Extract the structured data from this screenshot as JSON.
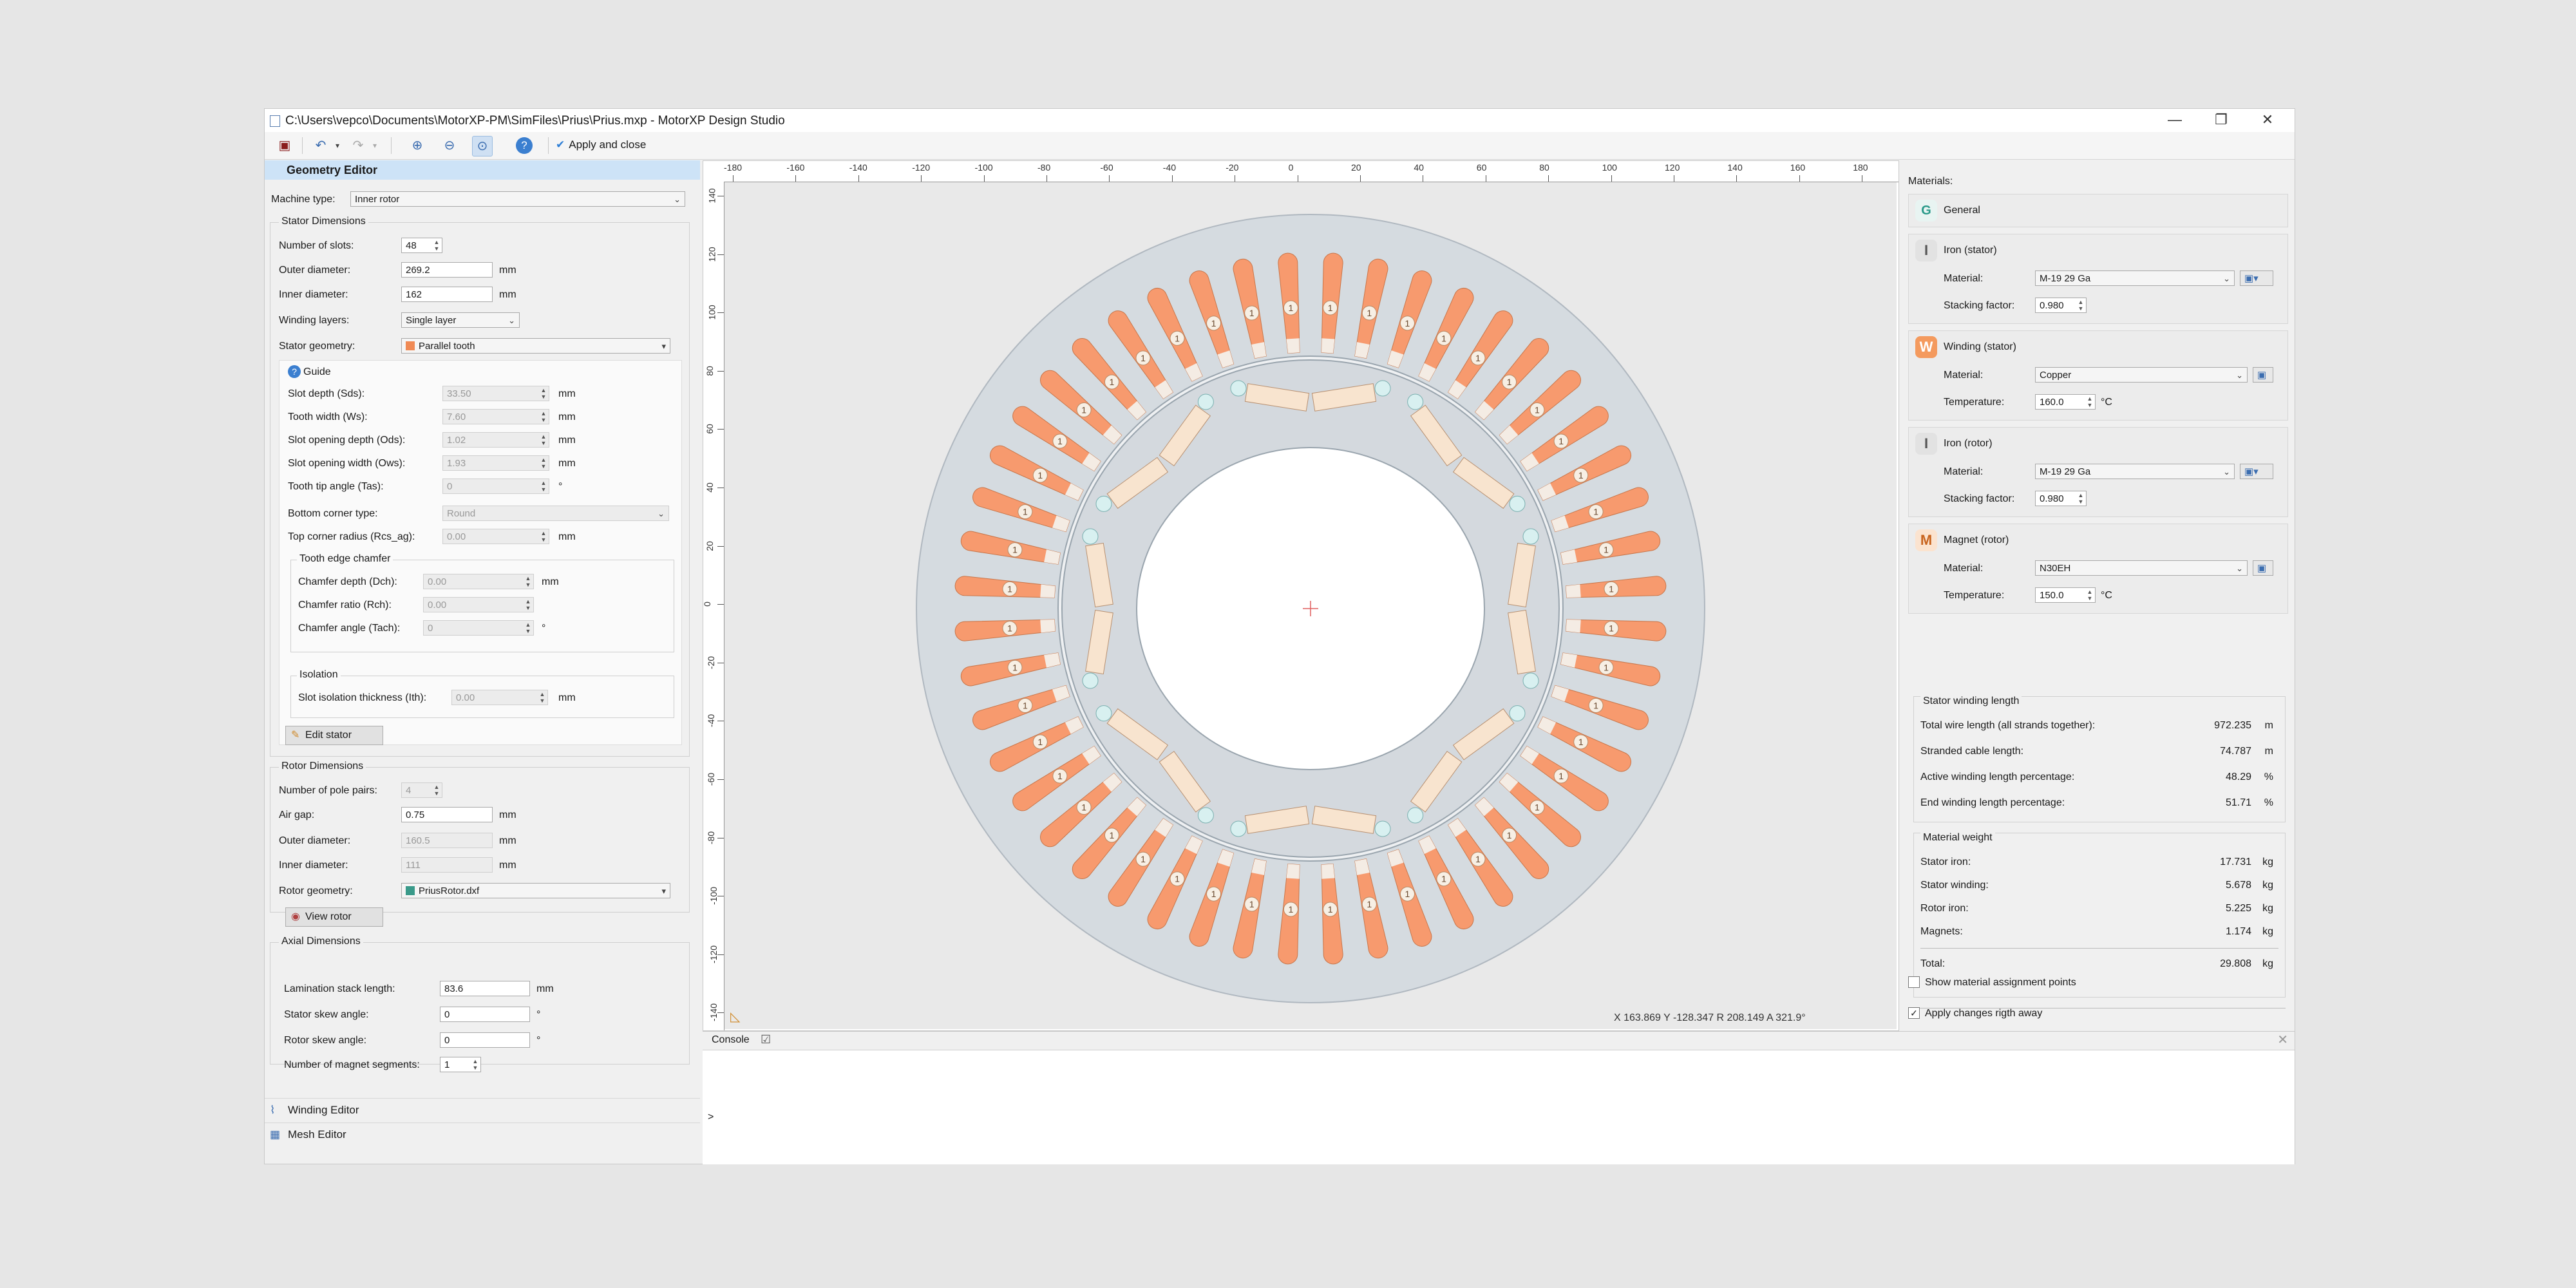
{
  "window": {
    "title": "C:\\Users\\vepco\\Documents\\MotorXP-PM\\SimFiles\\Prius\\Prius.mxp - MotorXP Design Studio",
    "minimize": "—",
    "maximize": "❐",
    "close": "✕"
  },
  "toolbar": {
    "apply_label": "Apply and close"
  },
  "left": {
    "header": "Geometry Editor",
    "machine_type_label": "Machine type:",
    "machine_type": "Inner rotor",
    "stator_group": "Stator Dimensions",
    "slots_label": "Number of slots:",
    "slots": "48",
    "outer_label": "Outer diameter:",
    "outer": "269.2",
    "inner_label": "Inner diameter:",
    "inner": "162",
    "mm": "mm",
    "winding_layers_label": "Winding layers:",
    "winding_layers": "Single layer",
    "stator_geometry_label": "Stator geometry:",
    "stator_geometry": "Parallel tooth",
    "guide": "Guide",
    "params": [
      {
        "label": "Slot depth (Sds):",
        "value": "33.50",
        "unit": "mm"
      },
      {
        "label": "Tooth width (Ws):",
        "value": "7.60",
        "unit": "mm"
      },
      {
        "label": "Slot opening depth (Ods):",
        "value": "1.02",
        "unit": "mm"
      },
      {
        "label": "Slot opening width (Ows):",
        "value": "1.93",
        "unit": "mm"
      },
      {
        "label": "Tooth tip angle (Tas):",
        "value": "0",
        "unit": "°"
      }
    ],
    "bottom_corner_label": "Bottom corner type:",
    "bottom_corner": "Round",
    "top_corner_label": "Top corner radius (Rcs_ag):",
    "top_corner": "0.00",
    "chamfer_group": "Tooth edge chamfer",
    "chamfer": [
      {
        "label": "Chamfer depth (Dch):",
        "value": "0.00",
        "unit": "mm"
      },
      {
        "label": "Chamfer ratio (Rch):",
        "value": "0.00",
        "unit": ""
      },
      {
        "label": "Chamfer angle (Tach):",
        "value": "0",
        "unit": "°"
      }
    ],
    "isolation_group": "Isolation",
    "isolation_label": "Slot isolation thickness (Ith):",
    "isolation": "0.00",
    "edit_stator": "Edit stator",
    "rotor_group": "Rotor Dimensions",
    "pole_pairs_label": "Number of pole pairs:",
    "pole_pairs": "4",
    "air_gap_label": "Air gap:",
    "air_gap": "0.75",
    "r_outer_label": "Outer diameter:",
    "r_outer": "160.5",
    "r_inner_label": "Inner diameter:",
    "r_inner": "111",
    "rotor_geometry_label": "Rotor geometry:",
    "rotor_geometry": "PriusRotor.dxf",
    "view_rotor": "View rotor",
    "axial_group": "Axial Dimensions",
    "stack_label": "Lamination stack length:",
    "stack": "83.6",
    "stator_skew_label": "Stator skew angle:",
    "stator_skew": "0",
    "rotor_skew_label": "Rotor skew angle:",
    "rotor_skew": "0",
    "segments_label": "Number of magnet segments:",
    "segments": "1",
    "deg": "°",
    "winding_editor": "Winding Editor",
    "mesh_editor": "Mesh Editor"
  },
  "canvas": {
    "x_ticks": [
      "-180",
      "-160",
      "-140",
      "-120",
      "-100",
      "-80",
      "-60",
      "-40",
      "-20",
      "0",
      "20",
      "40",
      "60",
      "80",
      "100",
      "120",
      "140",
      "160",
      "180"
    ],
    "y_ticks": [
      "140",
      "120",
      "100",
      "80",
      "60",
      "40",
      "20",
      "0",
      "-20",
      "-40",
      "-60",
      "-80",
      "-100",
      "-120",
      "-140"
    ],
    "slot_label": "1",
    "status": "X  163.869     Y  -128.347    R  208.149   A  321.9°",
    "colors": {
      "stator": "#d5dbe0",
      "coil": "#f79a6e",
      "slot_tip": "#f4ece4",
      "rotor": "#d4d9de",
      "magnet": "#f8e4cf",
      "hole": "#ffffff"
    }
  },
  "right": {
    "materials_label": "Materials:",
    "general": "General",
    "cards": [
      {
        "badge": "I",
        "title": "Iron (stator)",
        "r1": "Material:",
        "v1": "M-19 29 Ga",
        "r2": "Stacking factor:",
        "v2": "0.980",
        "u2": ""
      },
      {
        "badge": "W",
        "title": "Winding (stator)",
        "r1": "Material:",
        "v1": "Copper",
        "r2": "Temperature:",
        "v2": "160.0",
        "u2": "°C"
      },
      {
        "badge": "I",
        "title": "Iron (rotor)",
        "r1": "Material:",
        "v1": "M-19 29 Ga",
        "r2": "Stacking factor:",
        "v2": "0.980",
        "u2": ""
      },
      {
        "badge": "M",
        "title": "Magnet (rotor)",
        "r1": "Material:",
        "v1": "N30EH",
        "r2": "Temperature:",
        "v2": "150.0",
        "u2": "°C"
      }
    ],
    "winding_length_title": "Stator winding length",
    "winding_length": [
      {
        "label": "Total wire length (all strands together):",
        "value": "972.235",
        "unit": "m"
      },
      {
        "label": "Stranded cable length:",
        "value": "74.787",
        "unit": "m"
      },
      {
        "label": "Active winding length percentage:",
        "value": "48.29",
        "unit": "%"
      },
      {
        "label": "End winding length percentage:",
        "value": "51.71",
        "unit": "%"
      }
    ],
    "weight_title": "Material weight",
    "weight": [
      {
        "label": "Stator iron:",
        "value": "17.731",
        "unit": "kg"
      },
      {
        "label": "Stator winding:",
        "value": "5.678",
        "unit": "kg"
      },
      {
        "label": "Rotor iron:",
        "value": "5.225",
        "unit": "kg"
      },
      {
        "label": "Magnets:",
        "value": "1.174",
        "unit": "kg"
      }
    ],
    "total_label": "Total:",
    "total_value": "29.808",
    "total_unit": "kg",
    "show_points": "Show material assignment points",
    "apply_changes": "Apply changes rigth away"
  },
  "console": {
    "tab": "Console",
    "prompt": ">"
  }
}
